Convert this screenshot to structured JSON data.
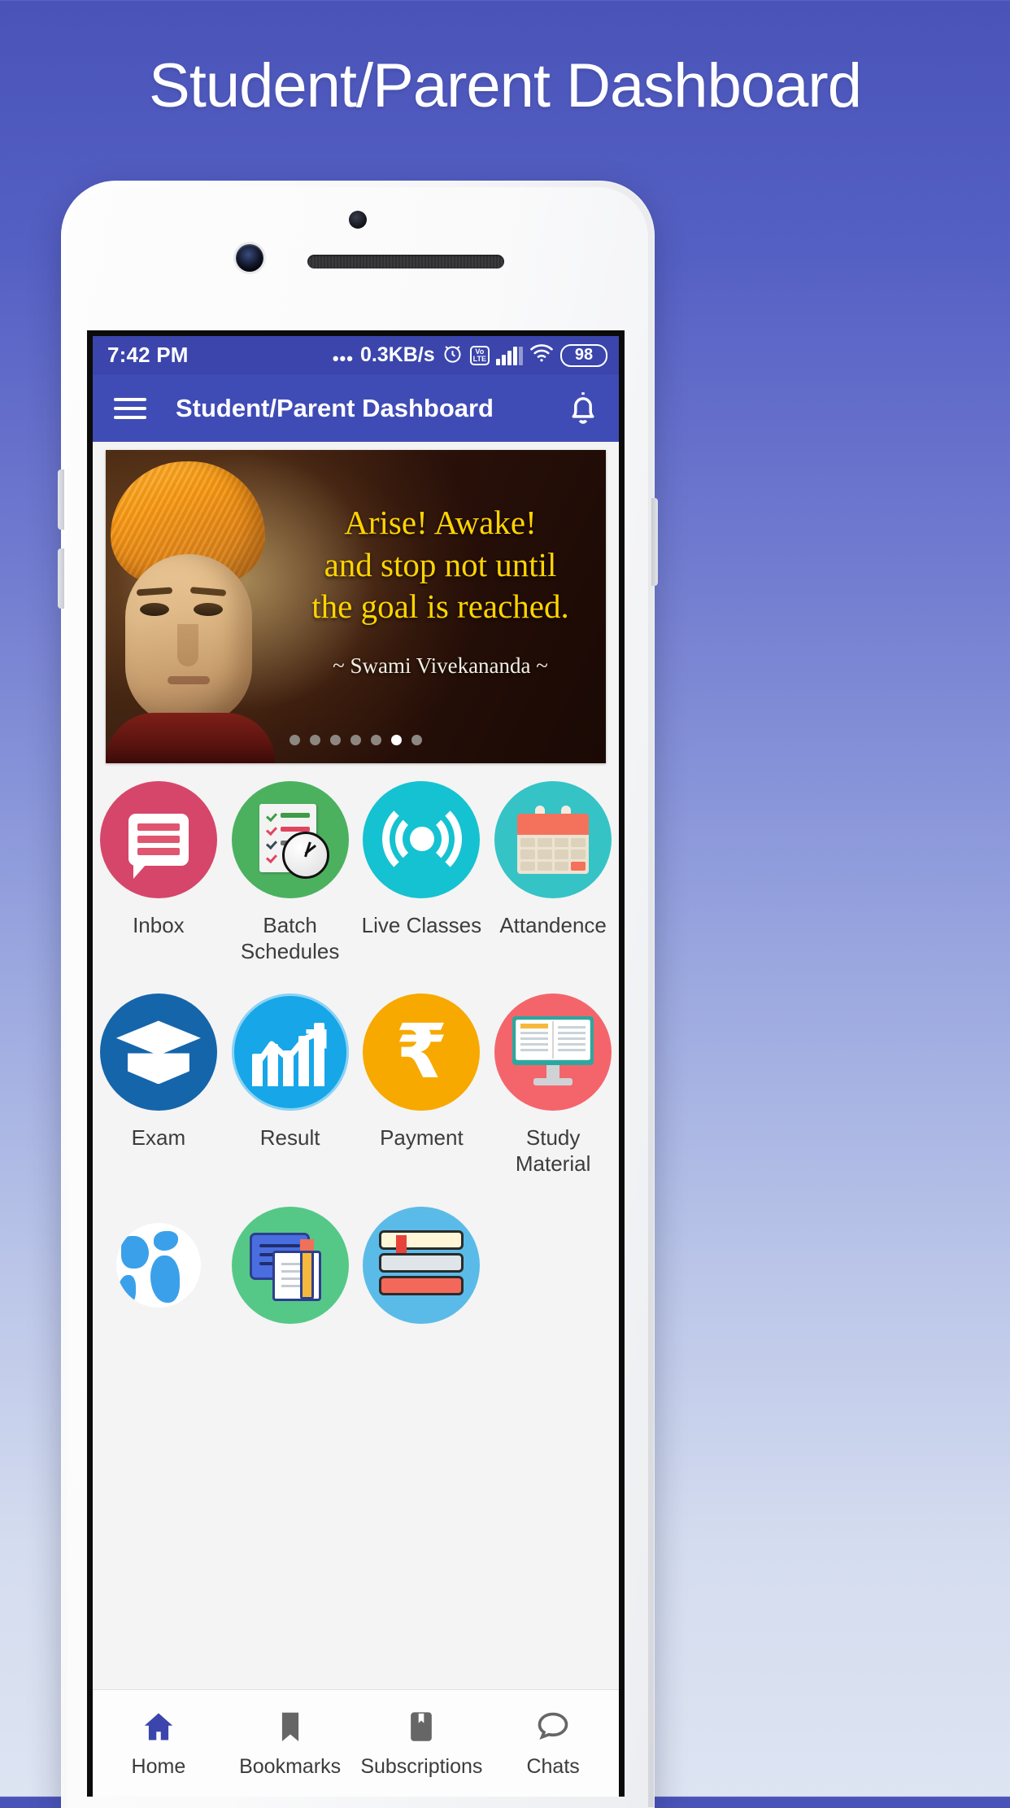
{
  "page": {
    "heading": "Student/Parent Dashboard"
  },
  "statusbar": {
    "time": "7:42 PM",
    "dots": "•••",
    "network_speed": "0.3KB/s",
    "alarm_icon": "alarm-clock-icon",
    "volte_line1": "Vo",
    "volte_line2": "LTE",
    "signal_icon": "signal-bars-icon",
    "wifi_icon": "wifi-icon",
    "battery_level": "98"
  },
  "appbar": {
    "menu_icon": "hamburger-menu-icon",
    "title": "Student/Parent Dashboard",
    "notification_icon": "bell-icon"
  },
  "banner": {
    "quote_line1": "Arise! Awake!",
    "quote_line2": "and stop not until",
    "quote_line3": "the goal is reached.",
    "author": "~ Swami Vivekananda ~",
    "dots_total": 7,
    "dots_active_index": 5
  },
  "grid": {
    "row1": [
      {
        "label": "Inbox",
        "icon": "chat-bubble-icon",
        "color": "#d6466a"
      },
      {
        "label": "Batch\nSchedules",
        "label_line1": "Batch",
        "label_line2": "Schedules",
        "icon": "schedule-checklist-clock-icon",
        "color": "#4cb15f"
      },
      {
        "label": "Live Classes",
        "icon": "live-broadcast-icon",
        "color": "#15c2d1"
      },
      {
        "label": "Attandence",
        "icon": "calendar-icon",
        "color": "#35c3c6"
      }
    ],
    "row2": [
      {
        "label": "Exam",
        "icon": "graduation-cap-icon",
        "color": "#1565ab"
      },
      {
        "label": "Result",
        "icon": "growth-chart-icon",
        "color": "#17a6e8"
      },
      {
        "label": "Payment",
        "icon": "rupee-icon",
        "color": "#f7a900",
        "glyph": "₹"
      },
      {
        "label": "Study Material",
        "icon": "monitor-book-icon",
        "color": "#f4656b"
      }
    ],
    "row3": [
      {
        "label": "",
        "icon": "globe-icon",
        "color": "#f4f4f4"
      },
      {
        "label": "",
        "icon": "notes-pencil-icon",
        "color": "#55c887"
      },
      {
        "label": "",
        "icon": "books-stack-icon",
        "color": "#5bbbe8"
      }
    ]
  },
  "bottomnav": {
    "items": [
      {
        "label": "Home",
        "icon": "home-icon",
        "active": true
      },
      {
        "label": "Bookmarks",
        "icon": "bookmark-icon",
        "active": false
      },
      {
        "label": "Subscriptions",
        "icon": "subscription-icon",
        "active": false
      },
      {
        "label": "Chats",
        "icon": "chat-icon",
        "active": false
      }
    ]
  },
  "colors": {
    "statusbar_bg": "#3b45ac",
    "appbar_bg": "#404cb5",
    "screen_bg": "#f4f4f4",
    "accent": "#3b45ac",
    "nav_active": "#3b45ac",
    "nav_inactive": "#666666"
  }
}
